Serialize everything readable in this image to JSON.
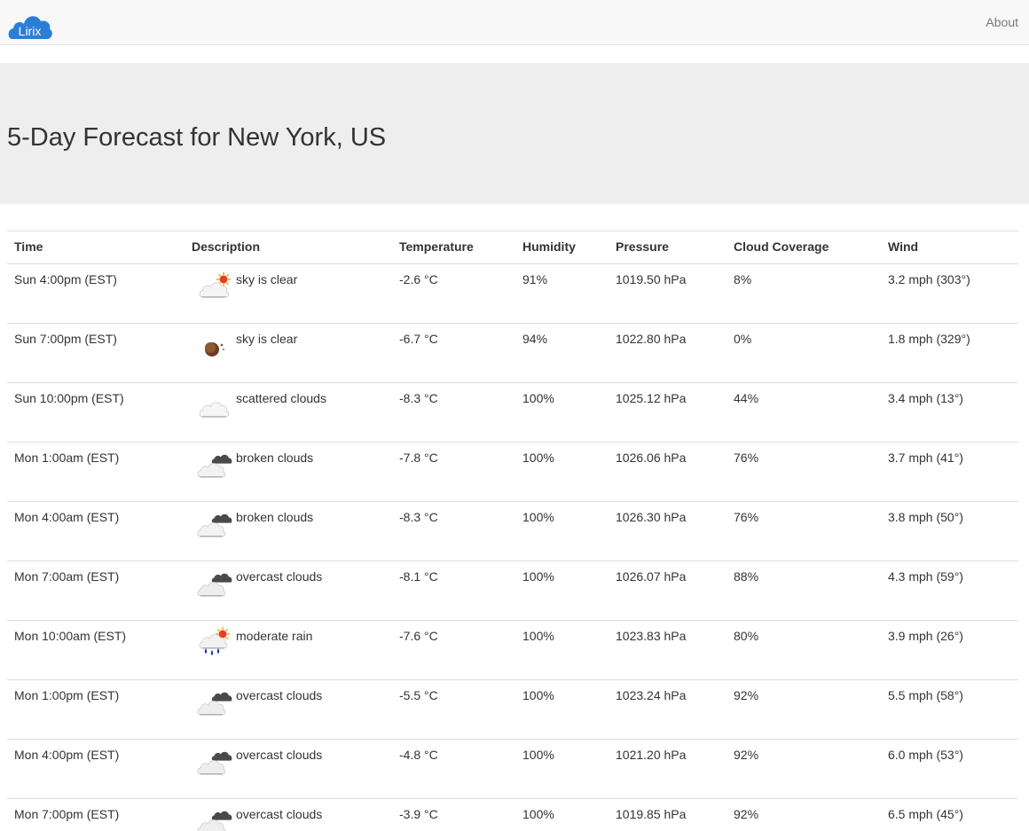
{
  "navbar": {
    "brand": "Lirix",
    "about_label": "About"
  },
  "page": {
    "title": "5-Day Forecast for New York, US"
  },
  "table": {
    "headers": [
      "Time",
      "Description",
      "Temperature",
      "Humidity",
      "Pressure",
      "Cloud Coverage",
      "Wind"
    ],
    "rows": [
      {
        "time": "Sun 4:00pm (EST)",
        "icon": "clear-day-icon",
        "description": "sky is clear",
        "temperature": "-2.6 °C",
        "humidity": "91%",
        "pressure": "1019.50 hPa",
        "clouds": "8%",
        "wind": "3.2 mph (303°)"
      },
      {
        "time": "Sun 7:00pm (EST)",
        "icon": "clear-night-icon",
        "description": "sky is clear",
        "temperature": "-6.7 °C",
        "humidity": "94%",
        "pressure": "1022.80 hPa",
        "clouds": "0%",
        "wind": "1.8 mph (329°)"
      },
      {
        "time": "Sun 10:00pm (EST)",
        "icon": "scattered-clouds-icon",
        "description": "scattered clouds",
        "temperature": "-8.3 °C",
        "humidity": "100%",
        "pressure": "1025.12 hPa",
        "clouds": "44%",
        "wind": "3.4 mph (13°)"
      },
      {
        "time": "Mon 1:00am (EST)",
        "icon": "broken-clouds-icon",
        "description": "broken clouds",
        "temperature": "-7.8 °C",
        "humidity": "100%",
        "pressure": "1026.06 hPa",
        "clouds": "76%",
        "wind": "3.7 mph (41°)"
      },
      {
        "time": "Mon 4:00am (EST)",
        "icon": "broken-clouds-icon",
        "description": "broken clouds",
        "temperature": "-8.3 °C",
        "humidity": "100%",
        "pressure": "1026.30 hPa",
        "clouds": "76%",
        "wind": "3.8 mph (50°)"
      },
      {
        "time": "Mon 7:00am (EST)",
        "icon": "overcast-clouds-icon",
        "description": "overcast clouds",
        "temperature": "-8.1 °C",
        "humidity": "100%",
        "pressure": "1026.07 hPa",
        "clouds": "88%",
        "wind": "4.3 mph (59°)"
      },
      {
        "time": "Mon 10:00am (EST)",
        "icon": "rain-icon",
        "description": "moderate rain",
        "temperature": "-7.6 °C",
        "humidity": "100%",
        "pressure": "1023.83 hPa",
        "clouds": "80%",
        "wind": "3.9 mph (26°)"
      },
      {
        "time": "Mon 1:00pm (EST)",
        "icon": "overcast-clouds-icon",
        "description": "overcast clouds",
        "temperature": "-5.5 °C",
        "humidity": "100%",
        "pressure": "1023.24 hPa",
        "clouds": "92%",
        "wind": "5.5 mph (58°)"
      },
      {
        "time": "Mon 4:00pm (EST)",
        "icon": "overcast-clouds-icon",
        "description": "overcast clouds",
        "temperature": "-4.8 °C",
        "humidity": "100%",
        "pressure": "1021.20 hPa",
        "clouds": "92%",
        "wind": "6.0 mph (53°)"
      },
      {
        "time": "Mon 7:00pm (EST)",
        "icon": "overcast-clouds-icon",
        "description": "overcast clouds",
        "temperature": "-3.9 °C",
        "humidity": "100%",
        "pressure": "1019.85 hPa",
        "clouds": "92%",
        "wind": "6.5 mph (45°)"
      }
    ]
  },
  "colors": {
    "brand_blue": "#2a7fd4",
    "navbar_bg": "#f8f8f8",
    "jumbotron_bg": "#eeeeee",
    "border": "#dddddd",
    "sun": "#f5a623",
    "rain": "#1a3fa0"
  }
}
